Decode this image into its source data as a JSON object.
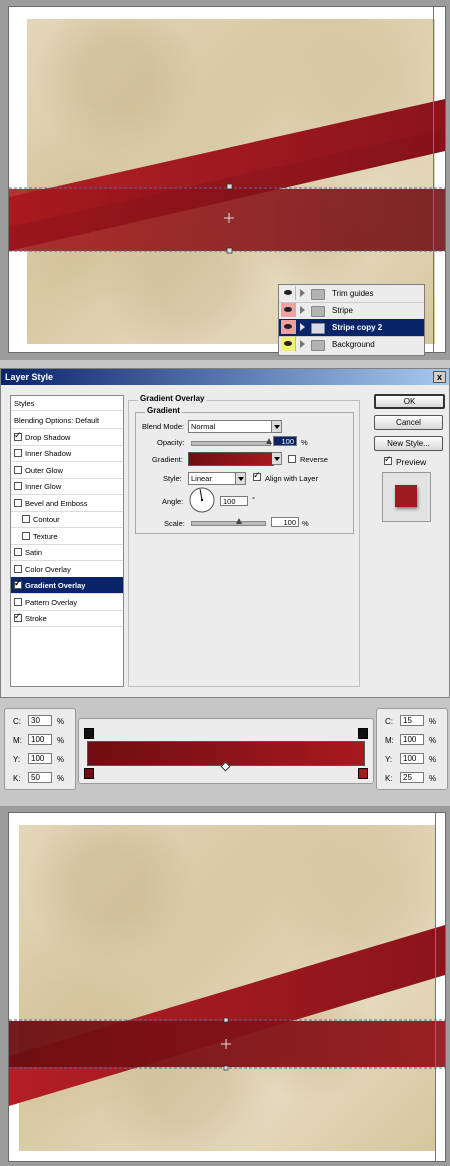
{
  "layers_panel": {
    "layers": [
      {
        "name": "Trim guides",
        "eye_color": "#ececec",
        "selected": false
      },
      {
        "name": "Stripe",
        "eye_color": "#f0a0a0",
        "selected": false
      },
      {
        "name": "Stripe copy 2",
        "eye_color": "#f0a0a0",
        "selected": true
      },
      {
        "name": "Background",
        "eye_color": "#f4f070",
        "selected": false
      }
    ]
  },
  "dialog": {
    "title": "Layer Style",
    "close_label": "x",
    "styles_header": "Styles",
    "style_items": [
      {
        "label": "Blending Options: Default",
        "checkbox": false,
        "checked": false,
        "indent": false,
        "selected": false
      },
      {
        "label": "Drop Shadow",
        "checkbox": true,
        "checked": true,
        "indent": false,
        "selected": false
      },
      {
        "label": "Inner Shadow",
        "checkbox": true,
        "checked": false,
        "indent": false,
        "selected": false
      },
      {
        "label": "Outer Glow",
        "checkbox": true,
        "checked": false,
        "indent": false,
        "selected": false
      },
      {
        "label": "Inner Glow",
        "checkbox": true,
        "checked": false,
        "indent": false,
        "selected": false
      },
      {
        "label": "Bevel and Emboss",
        "checkbox": true,
        "checked": false,
        "indent": false,
        "selected": false
      },
      {
        "label": "Contour",
        "checkbox": true,
        "checked": false,
        "indent": true,
        "selected": false
      },
      {
        "label": "Texture",
        "checkbox": true,
        "checked": false,
        "indent": true,
        "selected": false
      },
      {
        "label": "Satin",
        "checkbox": true,
        "checked": false,
        "indent": false,
        "selected": false
      },
      {
        "label": "Color Overlay",
        "checkbox": true,
        "checked": false,
        "indent": false,
        "selected": false
      },
      {
        "label": "Gradient Overlay",
        "checkbox": true,
        "checked": true,
        "indent": false,
        "selected": true
      },
      {
        "label": "Pattern Overlay",
        "checkbox": true,
        "checked": false,
        "indent": false,
        "selected": false
      },
      {
        "label": "Stroke",
        "checkbox": true,
        "checked": true,
        "indent": false,
        "selected": false
      }
    ],
    "section_title": "Gradient Overlay",
    "group_title": "Gradient",
    "blend_mode_label": "Blend Mode:",
    "blend_mode_value": "Normal",
    "opacity_label": "Opacity:",
    "opacity_value": "100",
    "opacity_level": 1.0,
    "percent": "%",
    "gradient_label": "Gradient:",
    "reverse_label": "Reverse",
    "reverse_checked": false,
    "style_label": "Style:",
    "style_value": "Linear",
    "align_label": "Align with Layer",
    "align_checked": true,
    "angle_label": "Angle:",
    "angle_value": "100",
    "degree": "°",
    "scale_label": "Scale:",
    "scale_value": "100",
    "scale_level": 0.66,
    "ok_label": "OK",
    "cancel_label": "Cancel",
    "new_style_label": "New Style...",
    "preview_label": "Preview",
    "preview_checked": true,
    "preview_color": "#9d1b20"
  },
  "gradient_editor": {
    "left_stop": {
      "C": "30",
      "M": "100",
      "Y": "100",
      "K": "50"
    },
    "right_stop": {
      "C": "15",
      "M": "100",
      "Y": "100",
      "K": "25"
    },
    "percent": "%",
    "left_color": "#6e0e12",
    "right_color": "#a8191e"
  },
  "colors": {
    "stripe_dark": "#7f1218",
    "stripe_light": "#b41e26",
    "selection": "#0a246a"
  }
}
